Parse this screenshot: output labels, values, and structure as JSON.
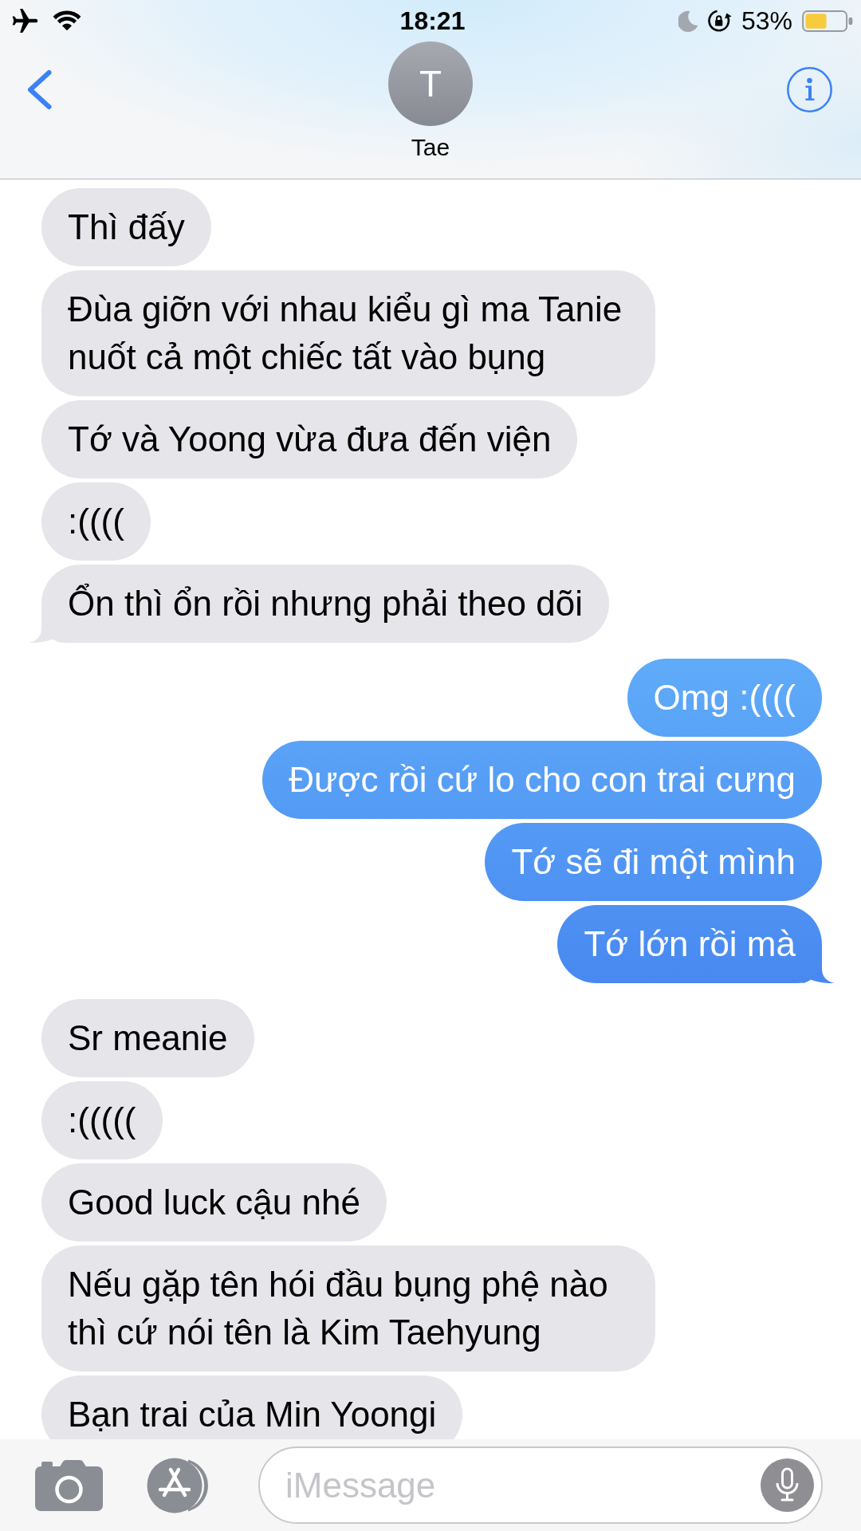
{
  "status_bar": {
    "time": "18:21",
    "battery": "53%"
  },
  "header": {
    "avatar_initial": "T",
    "contact_name": "Tae"
  },
  "messages": [
    {
      "kind": "received",
      "text": "Thì đấy",
      "tail": false
    },
    {
      "kind": "received",
      "text": "Đùa giỡn với nhau kiểu gì ma Tanie nuốt cả một chiếc tất vào bụng",
      "tail": false
    },
    {
      "kind": "received",
      "text": "Tớ và Yoong vừa đưa đến viện",
      "tail": false
    },
    {
      "kind": "received",
      "text": ":((((",
      "tail": false
    },
    {
      "kind": "received",
      "text": "Ổn thì ổn rồi nhưng phải theo dõi",
      "tail": true
    },
    {
      "kind": "sent",
      "text": "Omg :((((",
      "tail": false
    },
    {
      "kind": "sent",
      "text": "Được rồi cứ lo cho con trai cưng",
      "tail": false
    },
    {
      "kind": "sent",
      "text": "Tớ sẽ đi một mình",
      "tail": false
    },
    {
      "kind": "sent",
      "text": "Tớ lớn rồi mà",
      "tail": true
    },
    {
      "kind": "received",
      "text": "Sr meanie",
      "tail": false
    },
    {
      "kind": "received",
      "text": ":(((((",
      "tail": false
    },
    {
      "kind": "received",
      "text": "Good luck cậu nhé",
      "tail": false
    },
    {
      "kind": "received",
      "text": "Nếu gặp tên hói đầu bụng phệ nào thì cứ nói tên là Kim Taehyung",
      "tail": false
    },
    {
      "kind": "received",
      "text": "Bạn trai của Min Yoongi",
      "tail": false
    }
  ],
  "composer": {
    "placeholder": "iMessage"
  }
}
